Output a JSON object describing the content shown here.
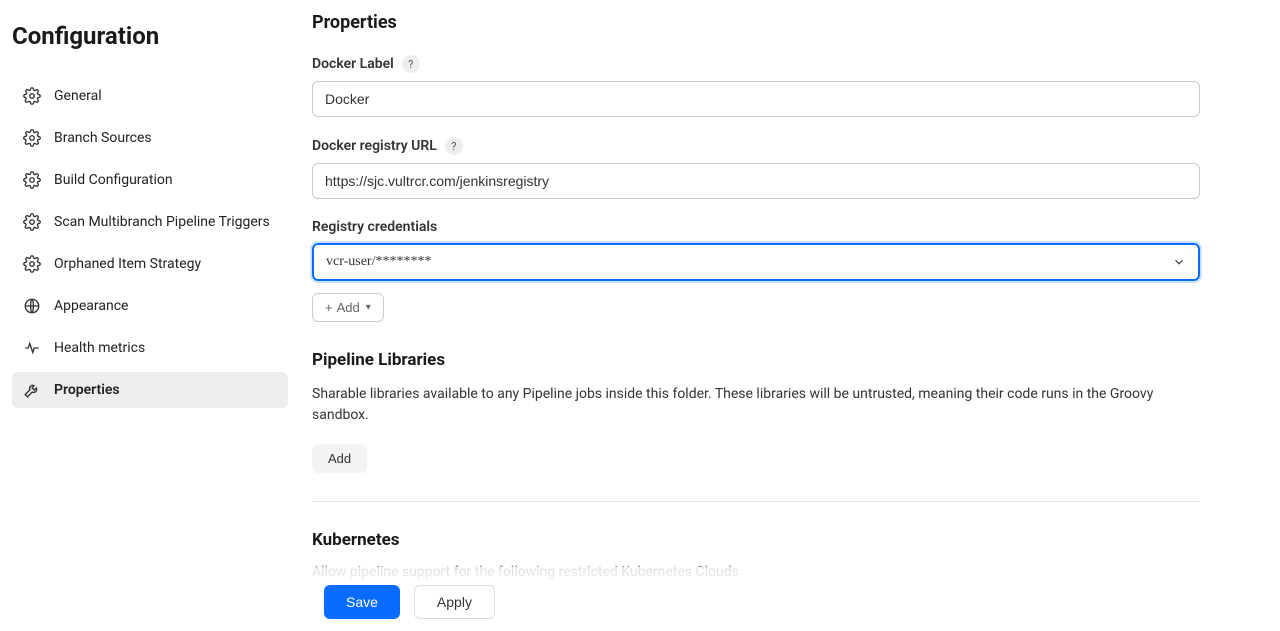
{
  "sidebar": {
    "title": "Configuration",
    "items": [
      {
        "label": "General",
        "icon": "gear"
      },
      {
        "label": "Branch Sources",
        "icon": "gear"
      },
      {
        "label": "Build Configuration",
        "icon": "gear"
      },
      {
        "label": "Scan Multibranch Pipeline Triggers",
        "icon": "gear"
      },
      {
        "label": "Orphaned Item Strategy",
        "icon": "gear"
      },
      {
        "label": "Appearance",
        "icon": "globe"
      },
      {
        "label": "Health metrics",
        "icon": "pulse"
      },
      {
        "label": "Properties",
        "icon": "wrench"
      }
    ],
    "active_index": 7
  },
  "main": {
    "heading": "Properties",
    "docker_label": {
      "label": "Docker Label",
      "value": "Docker"
    },
    "docker_registry_url": {
      "label": "Docker registry URL",
      "value": "https://sjc.vultrcr.com/jenkinsregistry"
    },
    "registry_credentials": {
      "label": "Registry credentials",
      "selected": "vcr-user/********"
    },
    "add_button": "Add",
    "pipeline_libraries": {
      "heading": "Pipeline Libraries",
      "description": "Sharable libraries available to any Pipeline jobs inside this folder. These libraries will be untrusted, meaning their code runs in the Groovy sandbox.",
      "add_label": "Add"
    },
    "kubernetes": {
      "heading": "Kubernetes",
      "description": "Allow pipeline support for the following restricted Kubernetes Clouds"
    }
  },
  "footer": {
    "save": "Save",
    "apply": "Apply"
  }
}
